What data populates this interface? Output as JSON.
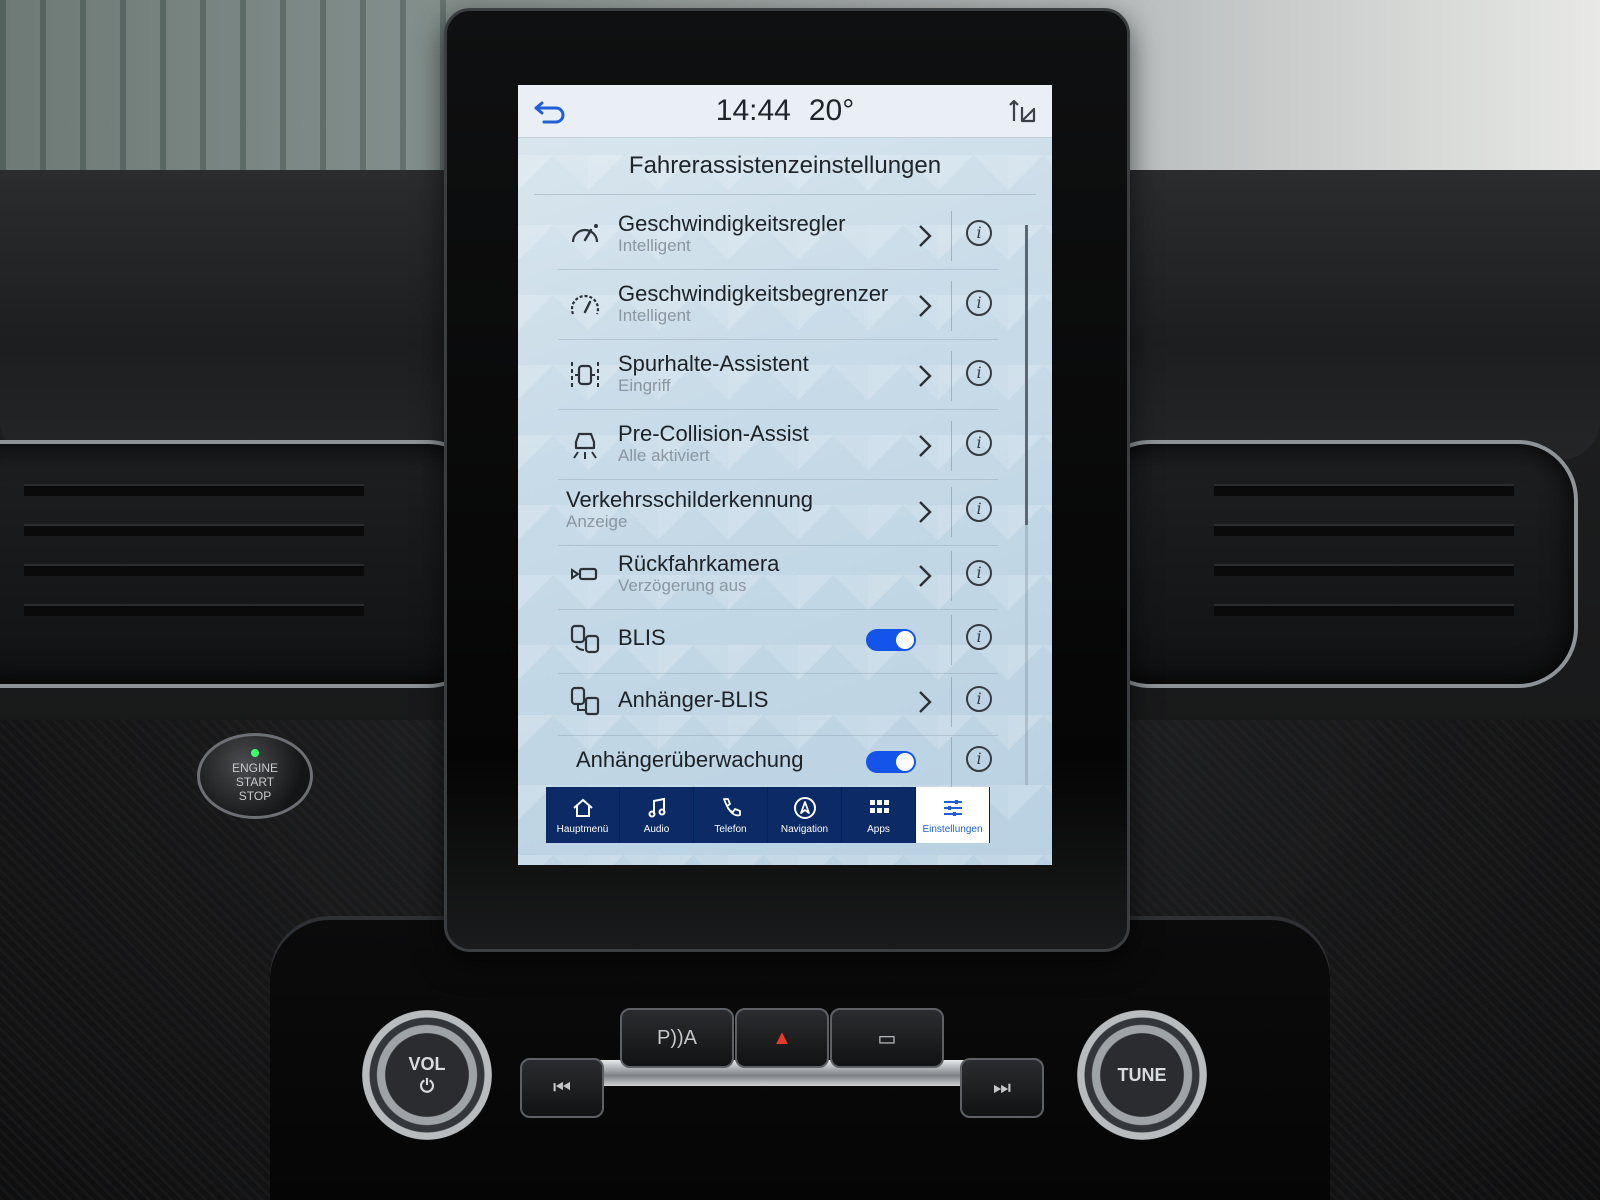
{
  "statusbar": {
    "time": "14:44",
    "temperature": "20°",
    "back_icon": "back-arrow-icon",
    "signal_icon": "signal-icon"
  },
  "page": {
    "title": "Fahrerassistenzeinstellungen"
  },
  "settings": [
    {
      "label": "Geschwindigkeitsregler",
      "sublabel": "Intelligent",
      "icon": "cruise-control-icon",
      "control": "chevron"
    },
    {
      "label": "Geschwindigkeitsbegrenzer",
      "sublabel": "Intelligent",
      "icon": "speed-limiter-icon",
      "control": "chevron"
    },
    {
      "label": "Spurhalte-Assistent",
      "sublabel": "Eingriff",
      "icon": "lane-keeping-icon",
      "control": "chevron"
    },
    {
      "label": "Pre-Collision-Assist",
      "sublabel": "Alle aktiviert",
      "icon": "pre-collision-icon",
      "control": "chevron"
    },
    {
      "label": "Verkehrsschilderkennung",
      "sublabel": "Anzeige",
      "icon": "",
      "control": "chevron"
    },
    {
      "label": "Rückfahrkamera",
      "sublabel": "Verzögerung aus",
      "icon": "rear-camera-icon",
      "control": "chevron"
    },
    {
      "label": "BLIS",
      "sublabel": "",
      "icon": "blind-spot-icon",
      "control": "toggle",
      "toggle_on": true
    },
    {
      "label": "Anhänger-BLIS",
      "sublabel": "",
      "icon": "trailer-blind-spot-icon",
      "control": "chevron"
    },
    {
      "label": "Anhängerüberwachung",
      "sublabel": "",
      "icon": "",
      "control": "toggle",
      "toggle_on": true
    }
  ],
  "navbar": {
    "items": [
      {
        "label": "Hauptmenü",
        "icon": "home-icon",
        "active": false
      },
      {
        "label": "Audio",
        "icon": "music-note-icon",
        "active": false
      },
      {
        "label": "Telefon",
        "icon": "phone-icon",
        "active": false
      },
      {
        "label": "Navigation",
        "icon": "navigation-icon",
        "active": false
      },
      {
        "label": "Apps",
        "icon": "apps-grid-icon",
        "active": false
      },
      {
        "label": "Einstellungen",
        "icon": "settings-sliders-icon",
        "active": true
      }
    ]
  },
  "hardware": {
    "start_button": [
      "ENGINE",
      "START",
      "STOP"
    ],
    "vol_knob": "VOL",
    "tune_knob": "TUNE",
    "parking_button": "P))A"
  },
  "colors": {
    "accent": "#1554e8",
    "navbar_bg": "#0b2a66",
    "active_tab": "#1f5fd6"
  }
}
